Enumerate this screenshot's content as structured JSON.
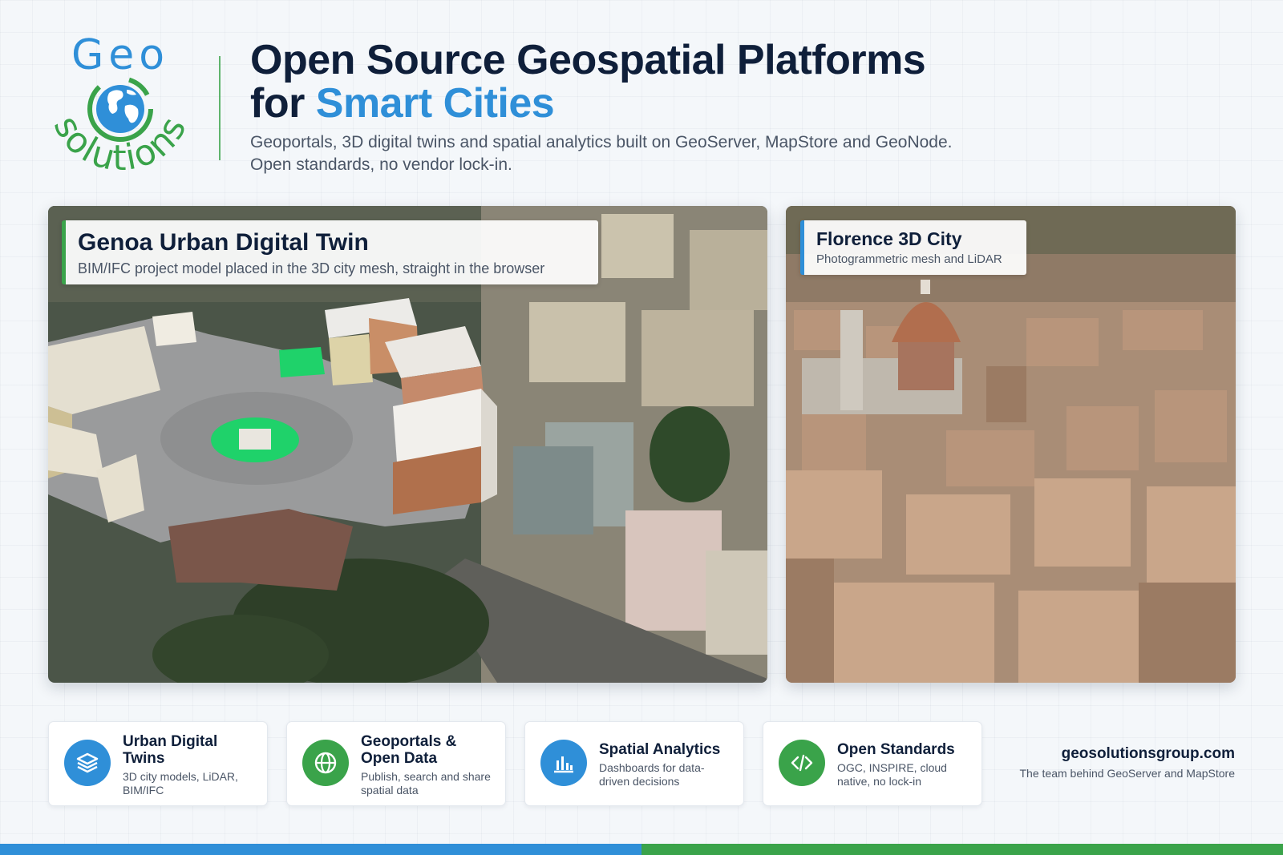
{
  "brand": {
    "logo_top": "Geo",
    "logo_bottom": "solutions",
    "colors": {
      "blue": "#2f8fd8",
      "green": "#3aa34a",
      "navy": "#0f1f3a"
    }
  },
  "header": {
    "title_line1": "Open Source Geospatial Platforms",
    "title_line2_prefix": "for ",
    "title_line2_accent": "Smart Cities",
    "subtitle_line1": "Geoportals, 3D digital twins and spatial analytics built on GeoServer, MapStore and GeoNode.",
    "subtitle_line2": "Open standards, no vendor lock-in."
  },
  "cards": [
    {
      "title": "Genoa Urban Digital Twin",
      "subtitle": "BIM/IFC project model placed in the 3D city mesh, straight in the browser"
    },
    {
      "title": "Florence 3D City",
      "subtitle": "Photogrammetric mesh and LiDAR"
    }
  ],
  "features": [
    {
      "title": "Urban Digital Twins",
      "desc": "3D city models, LiDAR, BIM/IFC",
      "icon": "layers-icon",
      "color": "#2f8fd8"
    },
    {
      "title": "Geoportals & Open Data",
      "desc": "Publish, search and share spatial data",
      "icon": "globe-icon",
      "color": "#3aa34a"
    },
    {
      "title": "Spatial Analytics",
      "desc": "Dashboards for data-driven decisions",
      "icon": "bar-chart-icon",
      "color": "#2f8fd8"
    },
    {
      "title": "Open Standards",
      "desc": "OGC, INSPIRE, cloud native, no lock-in",
      "icon": "code-icon",
      "color": "#3aa34a"
    }
  ],
  "footer": {
    "website": "geosolutionsgroup.com",
    "tagline": "The team behind GeoServer and MapStore"
  }
}
